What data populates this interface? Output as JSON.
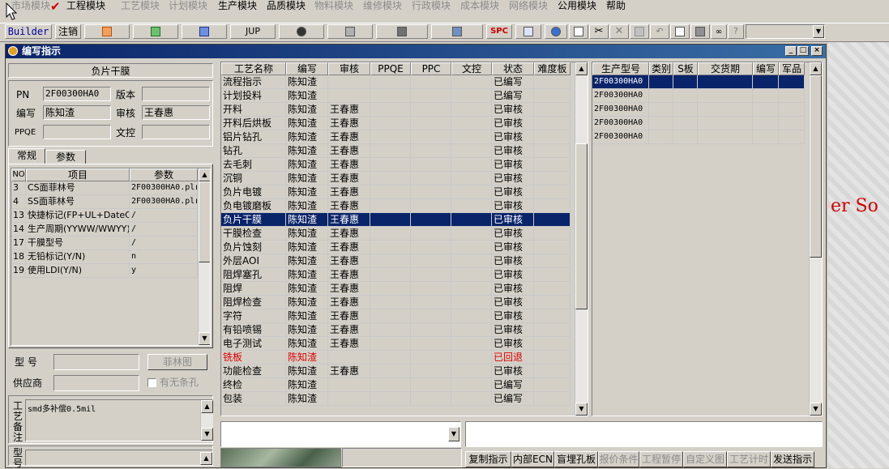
{
  "menu": {
    "items": [
      {
        "label": "市场模块",
        "enabled": false
      },
      {
        "label": "工程模块",
        "enabled": true
      },
      {
        "label": "工艺模块",
        "enabled": false
      },
      {
        "label": "计划模块",
        "enabled": false
      },
      {
        "label": "生产模块",
        "enabled": true
      },
      {
        "label": "品质模块",
        "enabled": true
      },
      {
        "label": "物料模块",
        "enabled": false
      },
      {
        "label": "维修模块",
        "enabled": false
      },
      {
        "label": "行政模块",
        "enabled": false
      },
      {
        "label": "成本模块",
        "enabled": false
      },
      {
        "label": "网络模块",
        "enabled": false
      },
      {
        "label": "公用模块",
        "enabled": true
      },
      {
        "label": "帮助",
        "enabled": true
      }
    ]
  },
  "toolbar": {
    "builder_label": "Builder",
    "logout_label": "注销",
    "jup_label": "JUP",
    "spc_label": "SPC",
    "combo_value": ""
  },
  "background": {
    "red_text": "er So"
  },
  "window": {
    "title": "编写指示",
    "min_label": "_",
    "max_label": "□",
    "close_label": "×",
    "left": {
      "heading": "负片干膜",
      "pn_label": "PN",
      "pn_value": "2F00300HA0",
      "version_label": "版本",
      "version_value": "",
      "author_label": "编写",
      "author_value": "陈知渣",
      "reviewer_label": "审核",
      "reviewer_value": "王春惠",
      "ppqe_label": "PPQE",
      "ppqe_value": "",
      "doc_label": "文控",
      "doc_value": "",
      "tabs": [
        "常规",
        "参数"
      ],
      "param_headers": [
        "NO",
        "项目",
        "参数"
      ],
      "params": [
        {
          "no": "3",
          "item": "CS面菲林号",
          "value": "2F00300HA0.plr"
        },
        {
          "no": "4",
          "item": "SS面菲林号",
          "value": "2F00300HA0.plr"
        },
        {
          "no": "13",
          "item": "快捷标记(FP+UL+DateC",
          "value": "/"
        },
        {
          "no": "14",
          "item": "生产周期(YYWW/WWYY)",
          "value": "/"
        },
        {
          "no": "17",
          "item": "干膜型号",
          "value": "/"
        },
        {
          "no": "18",
          "item": "无铅标记(Y/N)",
          "value": "n"
        },
        {
          "no": "19",
          "item": "使用LDI(Y/N)",
          "value": "y"
        }
      ],
      "model_label": "型 号",
      "model_value": "",
      "film_button": "菲林图",
      "supplier_label": "供应商",
      "supplier_value": "",
      "barcode_label": "有无条孔",
      "barcode_checked": false,
      "remark_label": "工艺备注",
      "remark_value": "smd多补偿0.5mil",
      "type_label": "型号",
      "type_value": ""
    },
    "process": {
      "headers": [
        "工艺名称",
        "编写",
        "审核",
        "PPQE",
        "PPC",
        "文控",
        "状态",
        "难度板"
      ],
      "rows": [
        {
          "name": "流程指示",
          "author": "陈知渣",
          "reviewer": "",
          "ppqe": "",
          "ppc": "",
          "doc": "",
          "status": "已编写",
          "diff": ""
        },
        {
          "name": "计划投料",
          "author": "陈知渣",
          "reviewer": "",
          "ppqe": "",
          "ppc": "",
          "doc": "",
          "status": "已编写",
          "diff": ""
        },
        {
          "name": "开料",
          "author": "陈知渣",
          "reviewer": "王春惠",
          "ppqe": "",
          "ppc": "",
          "doc": "",
          "status": "已审核",
          "diff": ""
        },
        {
          "name": "开料后烘板",
          "author": "陈知渣",
          "reviewer": "王春惠",
          "ppqe": "",
          "ppc": "",
          "doc": "",
          "status": "已审核",
          "diff": ""
        },
        {
          "name": "铝片钻孔",
          "author": "陈知渣",
          "reviewer": "王春惠",
          "ppqe": "",
          "ppc": "",
          "doc": "",
          "status": "已审核",
          "diff": ""
        },
        {
          "name": "钻孔",
          "author": "陈知渣",
          "reviewer": "王春惠",
          "ppqe": "",
          "ppc": "",
          "doc": "",
          "status": "已审核",
          "diff": ""
        },
        {
          "name": "去毛刺",
          "author": "陈知渣",
          "reviewer": "王春惠",
          "ppqe": "",
          "ppc": "",
          "doc": "",
          "status": "已审核",
          "diff": ""
        },
        {
          "name": "沉铜",
          "author": "陈知渣",
          "reviewer": "王春惠",
          "ppqe": "",
          "ppc": "",
          "doc": "",
          "status": "已审核",
          "diff": ""
        },
        {
          "name": "负片电镀",
          "author": "陈知渣",
          "reviewer": "王春惠",
          "ppqe": "",
          "ppc": "",
          "doc": "",
          "status": "已审核",
          "diff": ""
        },
        {
          "name": "负电镀磨板",
          "author": "陈知渣",
          "reviewer": "王春惠",
          "ppqe": "",
          "ppc": "",
          "doc": "",
          "status": "已审核",
          "diff": ""
        },
        {
          "name": "负片干膜",
          "author": "陈知渣",
          "reviewer": "王春惠",
          "ppqe": "",
          "ppc": "",
          "doc": "",
          "status": "已审核",
          "diff": "",
          "selected": true
        },
        {
          "name": "干膜检查",
          "author": "陈知渣",
          "reviewer": "王春惠",
          "ppqe": "",
          "ppc": "",
          "doc": "",
          "status": "已审核",
          "diff": ""
        },
        {
          "name": "负片蚀刻",
          "author": "陈知渣",
          "reviewer": "王春惠",
          "ppqe": "",
          "ppc": "",
          "doc": "",
          "status": "已审核",
          "diff": ""
        },
        {
          "name": "外层AOI",
          "author": "陈知渣",
          "reviewer": "王春惠",
          "ppqe": "",
          "ppc": "",
          "doc": "",
          "status": "已审核",
          "diff": ""
        },
        {
          "name": "阻焊塞孔",
          "author": "陈知渣",
          "reviewer": "王春惠",
          "ppqe": "",
          "ppc": "",
          "doc": "",
          "status": "已审核",
          "diff": ""
        },
        {
          "name": "阻焊",
          "author": "陈知渣",
          "reviewer": "王春惠",
          "ppqe": "",
          "ppc": "",
          "doc": "",
          "status": "已审核",
          "diff": ""
        },
        {
          "name": "阻焊检查",
          "author": "陈知渣",
          "reviewer": "王春惠",
          "ppqe": "",
          "ppc": "",
          "doc": "",
          "status": "已审核",
          "diff": ""
        },
        {
          "name": "字符",
          "author": "陈知渣",
          "reviewer": "王春惠",
          "ppqe": "",
          "ppc": "",
          "doc": "",
          "status": "已审核",
          "diff": ""
        },
        {
          "name": "有铅喷锡",
          "author": "陈知渣",
          "reviewer": "王春惠",
          "ppqe": "",
          "ppc": "",
          "doc": "",
          "status": "已审核",
          "diff": ""
        },
        {
          "name": "电子测试",
          "author": "陈知渣",
          "reviewer": "王春惠",
          "ppqe": "",
          "ppc": "",
          "doc": "",
          "status": "已审核",
          "diff": ""
        },
        {
          "name": "铣板",
          "author": "陈知渣",
          "reviewer": "",
          "ppqe": "",
          "ppc": "",
          "doc": "",
          "status": "已回退",
          "diff": "",
          "red": true
        },
        {
          "name": "功能检查",
          "author": "陈知渣",
          "reviewer": "王春惠",
          "ppqe": "",
          "ppc": "",
          "doc": "",
          "status": "已审核",
          "diff": ""
        },
        {
          "name": "终检",
          "author": "陈知渣",
          "reviewer": "",
          "ppqe": "",
          "ppc": "",
          "doc": "",
          "status": "已编写",
          "diff": ""
        },
        {
          "name": "包装",
          "author": "陈知渣",
          "reviewer": "",
          "ppqe": "",
          "ppc": "",
          "doc": "",
          "status": "已编写",
          "diff": ""
        }
      ]
    },
    "production": {
      "headers": [
        "生产型号",
        "类别",
        "S板",
        "交货期",
        "编写",
        "军品"
      ],
      "rows": [
        {
          "model": "2F00300HA0",
          "selected": true
        },
        {
          "model": "2F00300HA0"
        },
        {
          "model": "2F00300HA0"
        },
        {
          "model": "2F00300HA0"
        },
        {
          "model": "2F00300HA0"
        }
      ]
    },
    "bottom": {
      "combo_value": "",
      "text_value": "",
      "buttons": [
        {
          "label": "复制指示",
          "enabled": true
        },
        {
          "label": "内部ECN",
          "enabled": true
        },
        {
          "label": "盲埋孔板",
          "enabled": true
        },
        {
          "label": "报价条件",
          "enabled": false
        },
        {
          "label": "工程暂停",
          "enabled": false
        },
        {
          "label": "自定义图",
          "enabled": false
        },
        {
          "label": "工艺计时",
          "enabled": false
        },
        {
          "label": "发送指示",
          "enabled": true
        }
      ]
    }
  }
}
